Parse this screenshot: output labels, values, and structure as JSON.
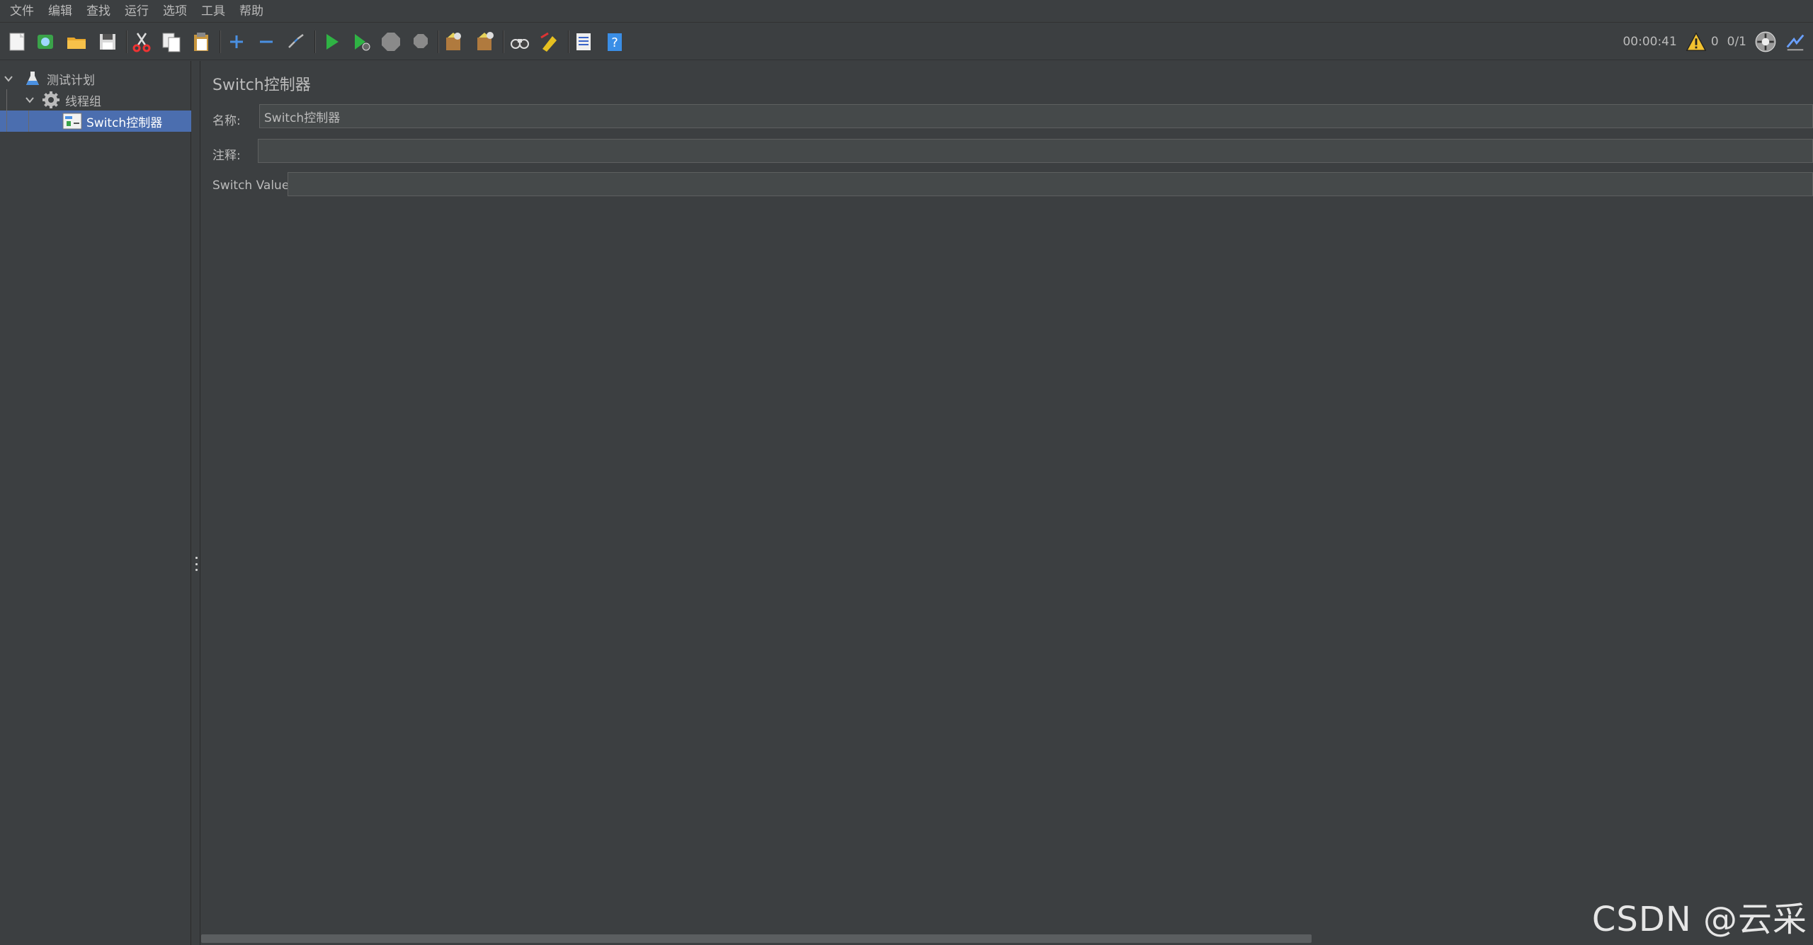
{
  "menu": [
    "文件",
    "编辑",
    "查找",
    "运行",
    "选项",
    "工具",
    "帮助"
  ],
  "toolbar": {
    "icons": [
      "new-icon",
      "templates-icon",
      "open-icon",
      "save-icon",
      "cut-icon",
      "copy-icon",
      "paste-icon",
      "expand-icon",
      "collapse-icon",
      "toggle-icon",
      "start-icon",
      "start-no-pause-icon",
      "stop-icon",
      "shutdown-icon",
      "clear-icon",
      "clear-all-icon",
      "search-icon",
      "reset-search-icon",
      "function-helper-icon",
      "help-icon"
    ]
  },
  "status": {
    "elapsed": "00:00:41",
    "warning_count": "0",
    "threads": "0/1"
  },
  "tree": {
    "items": [
      {
        "label": "测试计划",
        "icon": "test-plan-icon"
      },
      {
        "label": "线程组",
        "icon": "thread-group-icon"
      },
      {
        "label": "Switch控制器",
        "icon": "switch-controller-icon"
      }
    ]
  },
  "panel": {
    "title": "Switch控制器",
    "name_label": "名称:",
    "name_value": "Switch控制器",
    "comment_label": "注释:",
    "comment_value": "",
    "switch_label": "Switch Value",
    "switch_value": ""
  },
  "watermark": "CSDN @云采",
  "colors": {
    "background": "#3c3f41",
    "selection": "#4b6eaf",
    "text": "#bbbbbb"
  }
}
